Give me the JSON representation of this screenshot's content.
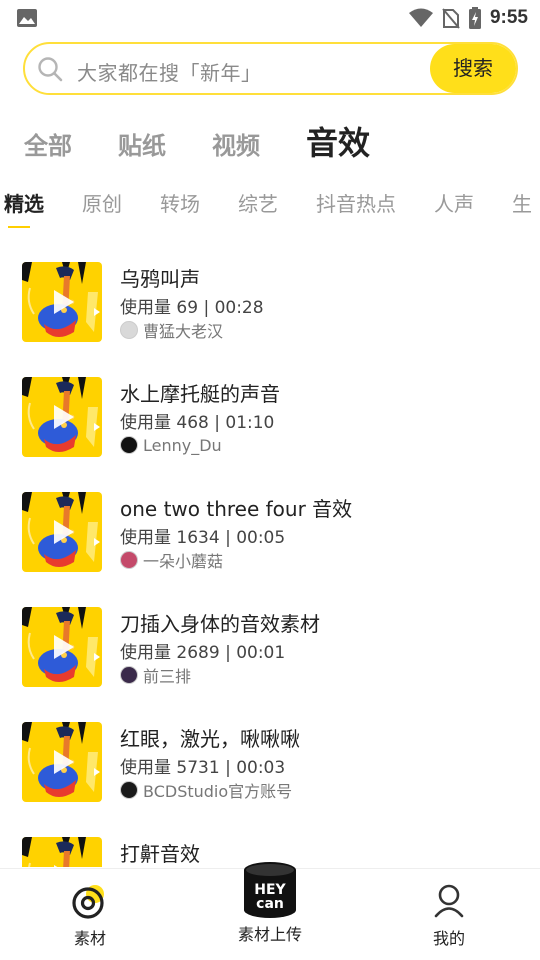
{
  "status_bar": {
    "time": "9:55"
  },
  "search": {
    "placeholder": "大家都在搜「新年」",
    "button_label": "搜索"
  },
  "main_tabs": [
    {
      "label": "全部",
      "active": false
    },
    {
      "label": "贴纸",
      "active": false
    },
    {
      "label": "视频",
      "active": false
    },
    {
      "label": "音效",
      "active": true
    }
  ],
  "sub_tabs": [
    {
      "label": "精选",
      "active": true
    },
    {
      "label": "原创",
      "active": false
    },
    {
      "label": "转场",
      "active": false
    },
    {
      "label": "综艺",
      "active": false
    },
    {
      "label": "抖音热点",
      "active": false
    },
    {
      "label": "人声",
      "active": false
    },
    {
      "label": "生",
      "active": false
    }
  ],
  "sounds": [
    {
      "title": "乌鸦叫声",
      "meta": "使用量 69 | 00:28",
      "author": "曹猛大老汉",
      "avatar_color": "#d9d9d9"
    },
    {
      "title": "水上摩托艇的声音",
      "meta": "使用量 468 | 01:10",
      "author": "Lenny_Du",
      "avatar_color": "#111111"
    },
    {
      "title": "one two three four 音效",
      "meta": "使用量 1634 | 00:05",
      "author": "一朵小蘑菇",
      "avatar_color": "#c44a6a"
    },
    {
      "title": "刀插入身体的音效素材",
      "meta": "使用量 2689 | 00:01",
      "author": "前三排",
      "avatar_color": "#3a2a4a"
    },
    {
      "title": "红眼，激光，啾啾啾",
      "meta": "使用量 5731 | 00:03",
      "author": "BCDStudio官方账号",
      "avatar_color": "#1a1a1a"
    },
    {
      "title": "打鼾音效",
      "meta": "",
      "author": "",
      "avatar_color": "#cccccc"
    }
  ],
  "bottom_nav": [
    {
      "label": "素材",
      "icon": "target-icon",
      "active": true
    },
    {
      "label": "素材上传",
      "icon": "heycan-logo",
      "logo_text_top": "HEY",
      "logo_text_bottom": "can",
      "active": false
    },
    {
      "label": "我的",
      "icon": "profile-icon",
      "active": false
    }
  ],
  "colors": {
    "accent": "#ffdf1a",
    "thumb_bg": "#ffd200",
    "note_blue": "#2e5bd8",
    "note_red": "#e83b2e"
  }
}
